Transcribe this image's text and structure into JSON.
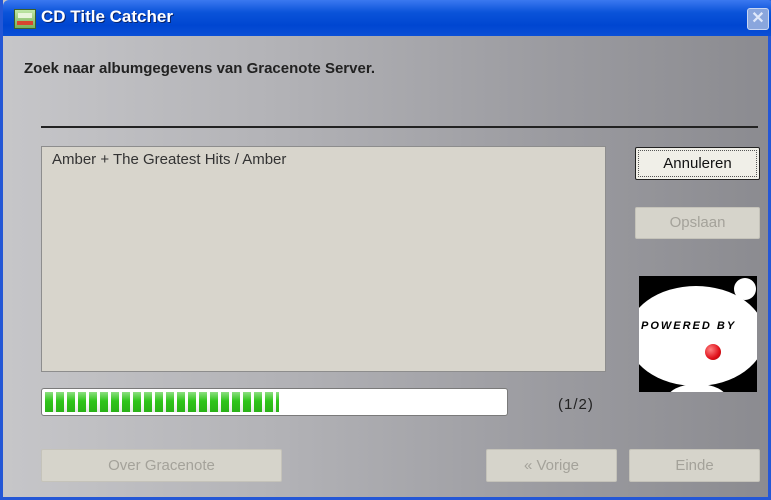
{
  "window": {
    "title": "CD Title Catcher"
  },
  "header": {
    "text": "Zoek naar albumgegevens van Gracenote Server."
  },
  "results": {
    "items": [
      "Amber + The Greatest Hits / Amber"
    ]
  },
  "buttons": {
    "cancel": "Annuleren",
    "save": "Opslaan",
    "about": "Over Gracenote",
    "previous": "« Vorige",
    "finish": "Einde"
  },
  "logo": {
    "text": "POWERED BY",
    "icon": "gracenote-logo"
  },
  "progress": {
    "fraction": 0.51,
    "counter": "(1/2)"
  },
  "colors": {
    "titlebar": "#0046d1",
    "progress": "#2fc51a",
    "logo_dot": "#e0101a"
  }
}
